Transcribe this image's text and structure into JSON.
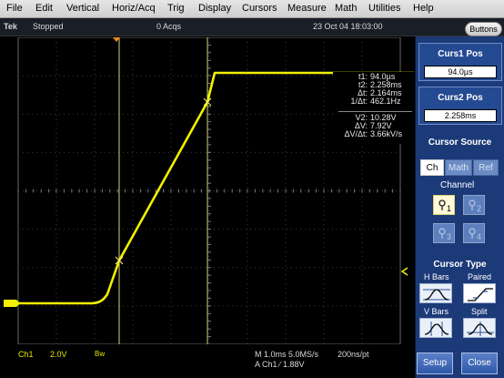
{
  "menubar": {
    "items": [
      "File",
      "Edit",
      "Vertical",
      "Horiz/Acq",
      "Trig",
      "Display",
      "Cursors",
      "Measure",
      "Math",
      "Utilities",
      "Help"
    ]
  },
  "status": {
    "brand": "Tek",
    "run_state": "Stopped",
    "acqs": "0 Acqs",
    "timestamp": "23 Oct 04 18:03:00",
    "buttons_label": "Buttons"
  },
  "readout": {
    "t1_label": "t1:",
    "t1_value": "94.0µs",
    "t2_label": "t2:",
    "t2_value": "2.258ms",
    "dt_label": "Δt:",
    "dt_value": "2.164ms",
    "inv_dt_label": "1/Δt:",
    "inv_dt_value": "462.1Hz",
    "v2_label": "V2:",
    "v2_value": "10.28V",
    "dv_label": "ΔV:",
    "dv_value": "7.92V",
    "dvdt_label": "ΔV/Δt:",
    "dvdt_value": "3.66kV/s"
  },
  "bottom": {
    "ch1_label": "Ch1",
    "ch1_scale": "2.0V",
    "bw_mark": "Bw",
    "timebase": "M 1.0ms 5.0MS/s",
    "sample_interval": "200ns/pt",
    "trigger_info": "A  Ch1  ∕  1.88V"
  },
  "panel": {
    "curs1_title": "Curs1 Pos",
    "curs1_value": "94.0µs",
    "curs2_title": "Curs2 Pos",
    "curs2_value": "2.258ms",
    "source_title": "Cursor Source",
    "tabs": [
      "Ch",
      "Math",
      "Ref"
    ],
    "channel_label": "Channel",
    "channels": [
      "1",
      "2",
      "3",
      "4"
    ],
    "cursor_type_title": "Cursor Type",
    "hbars_label": "H Bars",
    "paired_label": "Paired",
    "vbars_label": "V Bars",
    "split_label": "Split",
    "setup_label": "Setup",
    "close_label": "Close"
  },
  "colors": {
    "trace": "#f0f000",
    "panel": "#1c3a78",
    "accent": "#244a92"
  },
  "icons": {
    "trigger_position": "trigger-position-icon",
    "channel_ground": "channel-1-ground-icon",
    "trigger_level": "trigger-level-icon"
  }
}
